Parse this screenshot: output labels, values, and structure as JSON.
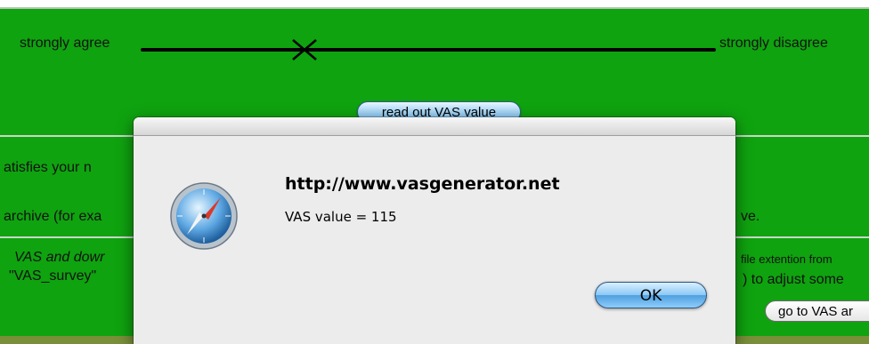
{
  "scale": {
    "left_label": "strongly agree",
    "right_label": "strongly disagree",
    "read_button_label": "read out VAS value"
  },
  "background_text": {
    "line1": "atisfies your n",
    "line2": "archive (for exa",
    "line2_right": "ve.",
    "line3": "VAS and dowr",
    "line3_right": "file extention from",
    "line4": "\"VAS_survey\"",
    "line4_right": ") to adjust some",
    "goto_button_label": "go to VAS ar"
  },
  "dialog": {
    "title": "http://www.vasgenerator.net",
    "message": "VAS value = 115",
    "ok_label": "OK",
    "icon": "safari-compass-icon"
  },
  "colors": {
    "page_green": "#0fa30f",
    "button_blue": "#8cc8f5"
  }
}
